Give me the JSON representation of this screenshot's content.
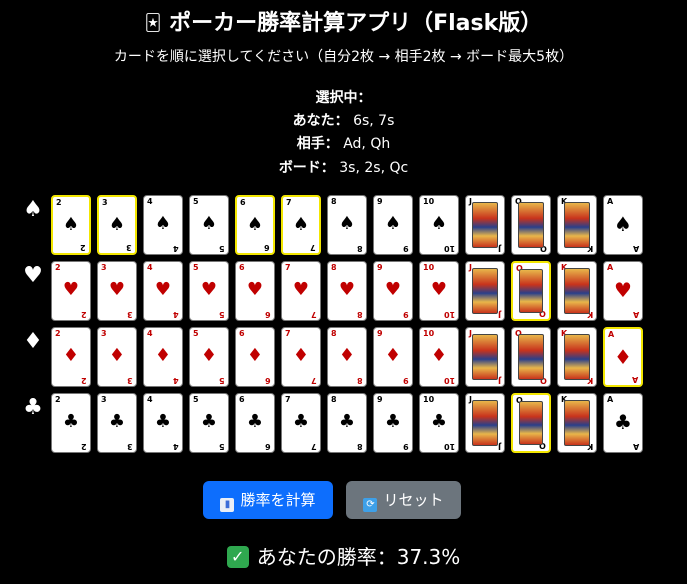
{
  "header": {
    "title": "ポーカー勝率計算アプリ（Flask版）",
    "title_icon": "🃏",
    "subtitle": "カードを順に選択してください（自分2枚 → 相手2枚 → ボード最大5枚）"
  },
  "selection": {
    "heading": "選択中：",
    "you_label": "あなた：",
    "you_value": "6s, 7s",
    "opp_label": "相手：",
    "opp_value": "Ad, Qh",
    "board_label": "ボード：",
    "board_value": "3s, 2s, Qc"
  },
  "suits": [
    {
      "code": "s",
      "symbol": "♠",
      "name": "spade",
      "color": "black"
    },
    {
      "code": "h",
      "symbol": "♥",
      "name": "heart",
      "color": "red"
    },
    {
      "code": "d",
      "symbol": "♦",
      "name": "diamond",
      "color": "red"
    },
    {
      "code": "c",
      "symbol": "♣",
      "name": "club",
      "color": "black"
    }
  ],
  "ranks": [
    "2",
    "3",
    "4",
    "5",
    "6",
    "7",
    "8",
    "9",
    "10",
    "J",
    "Q",
    "K",
    "A"
  ],
  "selected_cards": [
    "2s",
    "3s",
    "6s",
    "7s",
    "Qh",
    "Ad",
    "Qc"
  ],
  "buttons": {
    "calculate": "勝率を計算",
    "reset": "リセット"
  },
  "result": {
    "text": "あなたの勝率：37.3%"
  },
  "colors": {
    "background": "#000000",
    "selected_border": "#f2e600",
    "primary_button": "#0d6efd",
    "secondary_button": "#6c757d",
    "red_suit": "#c00000"
  }
}
